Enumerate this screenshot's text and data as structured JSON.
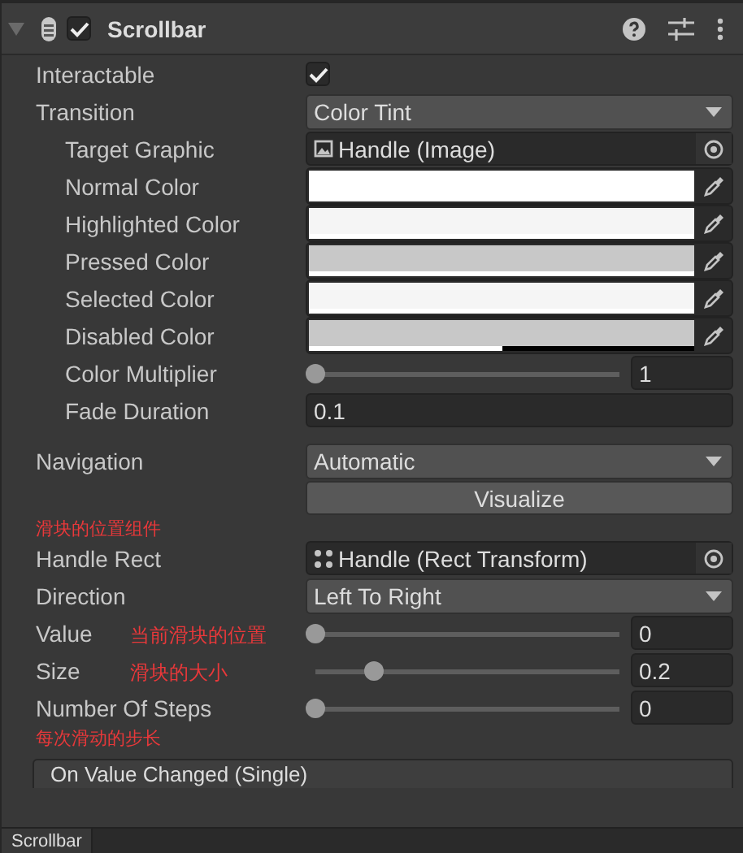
{
  "header": {
    "title": "Scrollbar",
    "enabled": true
  },
  "rows": [
    {
      "kind": "checkbox",
      "label": "Interactable",
      "checked": true
    },
    {
      "kind": "dropdown",
      "label": "Transition",
      "value": "Color Tint",
      "children": [
        {
          "kind": "image-ref",
          "label": "Target Graphic",
          "value": "Handle (Image)"
        },
        {
          "kind": "color",
          "label": "Normal Color",
          "color": "#ffffff",
          "level": 1
        },
        {
          "kind": "color",
          "label": "Highlighted Color",
          "color": "#f5f5f5",
          "level": 1
        },
        {
          "kind": "color",
          "label": "Pressed Color",
          "color": "#c8c8c8",
          "level": 1
        },
        {
          "kind": "color",
          "label": "Selected Color",
          "color": "#f5f5f5",
          "level": 1
        },
        {
          "kind": "color",
          "label": "Disabled Color",
          "color": "#c8c8c8",
          "level": 0.5
        },
        {
          "kind": "slider",
          "label": "Color Multiplier",
          "level": 0,
          "reading": "1"
        },
        {
          "kind": "number",
          "label": "Fade Duration",
          "value": "0.1"
        }
      ]
    },
    {
      "kind": "spacer"
    },
    {
      "kind": "dropdown",
      "label": "Navigation",
      "value": "Automatic"
    },
    {
      "kind": "button",
      "value": "Visualize"
    },
    {
      "kind": "note",
      "value": "滑块的位置组件"
    },
    {
      "kind": "transform-ref",
      "label": "Handle Rect",
      "value": "Handle (Rect Transform)"
    },
    {
      "kind": "dropdown",
      "label": "Direction",
      "value": "Left To Right"
    },
    {
      "kind": "slider",
      "label": "Value",
      "level": 0,
      "reading": "0",
      "note": "当前滑块的位置"
    },
    {
      "kind": "slider",
      "label": "Size",
      "level": 0.2,
      "reading": "0.2",
      "note": "滑块的大小"
    },
    {
      "kind": "slider",
      "label": "Number Of Steps",
      "level": 0,
      "reading": "0"
    },
    {
      "kind": "note",
      "value": "每次滑动的步长"
    }
  ],
  "event": {
    "title": "On Value Changed (Single)"
  },
  "footer": {
    "tab": "Scrollbar"
  }
}
